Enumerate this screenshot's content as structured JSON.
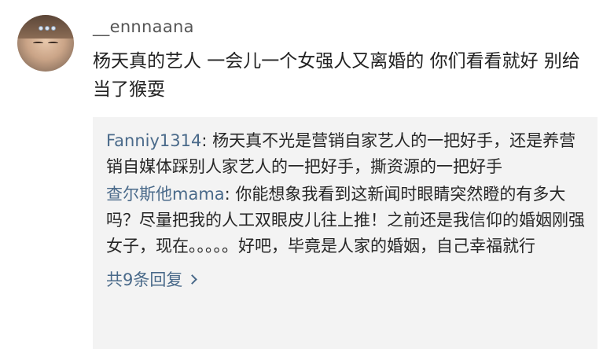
{
  "comment": {
    "username": "__ennnaana",
    "text": "杨天真的艺人  一会儿一个女强人又离婚的 你们看看就好 别给当了猴耍",
    "replies": [
      {
        "author": "Fanniy1314",
        "text": "杨天真不光是营销自家艺人的一把好手，还是养营销自媒体踩别人家艺人的一把好手，撕资源的一把好手"
      },
      {
        "author": "查尔斯他mama",
        "text": "你能想象我看到这新闻时眼睛突然瞪的有多大吗？尽量把我的人工双眼皮儿往上推！之前还是我信仰的婚姻刚强女子，现在。。。。。好吧，毕竟是人家的婚姻，自己幸福就行"
      }
    ],
    "more_replies_label": "共9条回复",
    "icons": {
      "more": "chevron-right-icon"
    }
  }
}
